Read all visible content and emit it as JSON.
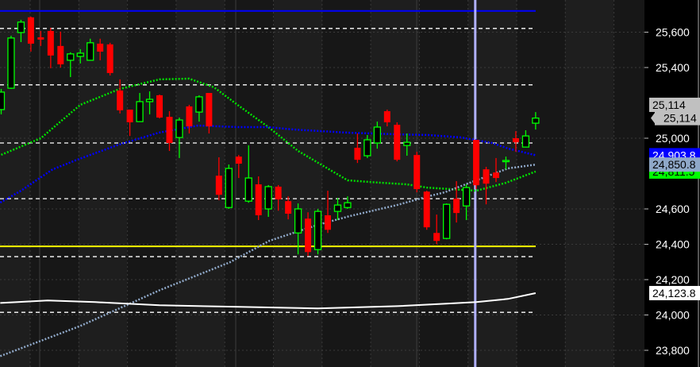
{
  "chart_data": {
    "type": "candlestick",
    "title": "",
    "ylim": [
      23760,
      25760
    ],
    "y_ticks": [
      "25,600",
      "25,400",
      "25,000",
      "24,600",
      "24,400",
      "24,200",
      "24,000",
      "23,800"
    ],
    "y_tick_values": [
      25600,
      25400,
      25000,
      24600,
      24400,
      24200,
      24000,
      23800
    ],
    "grid": true,
    "colors": {
      "up": "#00ff00",
      "down": "#ff0000",
      "background": "#1a1a1a",
      "axis_bg": "#000000"
    },
    "candles": [
      [
        25162,
        25279,
        25135,
        25261
      ],
      [
        25283,
        25580,
        25279,
        25567
      ],
      [
        25598,
        25670,
        25544,
        25657
      ],
      [
        25684,
        25688,
        25490,
        25535
      ],
      [
        25571,
        25607,
        25522,
        25558
      ],
      [
        25607,
        25625,
        25396,
        25468
      ],
      [
        25522,
        25603,
        25400,
        25418
      ],
      [
        25441,
        25486,
        25346,
        25477
      ],
      [
        25463,
        25504,
        25423,
        25481
      ],
      [
        25441,
        25563,
        25441,
        25540
      ],
      [
        25535,
        25563,
        25441,
        25490
      ],
      [
        25531,
        25540,
        25355,
        25369
      ],
      [
        25270,
        25333,
        25140,
        25158
      ],
      [
        25162,
        25162,
        25013,
        25090
      ],
      [
        25094,
        25256,
        25094,
        25207
      ],
      [
        25207,
        25265,
        25135,
        25220
      ],
      [
        25243,
        25247,
        25112,
        25117
      ],
      [
        25121,
        25153,
        24928,
        24973
      ],
      [
        25004,
        25117,
        24888,
        25103
      ],
      [
        25180,
        25189,
        25027,
        25067
      ],
      [
        25148,
        25243,
        25094,
        25234
      ],
      [
        25256,
        25256,
        25027,
        25067
      ],
      [
        24788,
        24892,
        24649,
        24680
      ],
      [
        24608,
        24851,
        24600,
        24829
      ],
      [
        24896,
        24905,
        24775,
        24856
      ],
      [
        24644,
        24960,
        24635,
        24775
      ],
      [
        24739,
        24784,
        24537,
        24564
      ],
      [
        24600,
        24735,
        24555,
        24726
      ],
      [
        24726,
        24735,
        24590,
        24654
      ],
      [
        24644,
        24671,
        24541,
        24573
      ],
      [
        24464,
        24631,
        24343,
        24600
      ],
      [
        24545,
        24581,
        24334,
        24356
      ],
      [
        24370,
        24600,
        24343,
        24586
      ],
      [
        24564,
        24703,
        24464,
        24482
      ],
      [
        24586,
        24662,
        24537,
        24622
      ],
      [
        24608,
        24671,
        24600,
        24635
      ],
      [
        24946,
        25027,
        24860,
        24878
      ],
      [
        24901,
        25018,
        24888,
        24991
      ],
      [
        24973,
        25094,
        24941,
        25063
      ],
      [
        25153,
        25162,
        25067,
        25090
      ],
      [
        25076,
        25090,
        24869,
        24878
      ],
      [
        24959,
        25027,
        24901,
        24977
      ],
      [
        24905,
        24923,
        24694,
        24712
      ],
      [
        24698,
        24703,
        24482,
        24496
      ],
      [
        24464,
        24568,
        24401,
        24419
      ],
      [
        24433,
        24631,
        24428,
        24626
      ],
      [
        24658,
        24757,
        24523,
        24577
      ],
      [
        24617,
        24739,
        24537,
        24721
      ],
      [
        24991,
        24991,
        24712,
        24734
      ],
      [
        24824,
        24838,
        24626,
        24743
      ],
      [
        24806,
        24888,
        24752,
        24775
      ],
      [
        24869,
        24896,
        24824,
        24874
      ],
      [
        25000,
        25040,
        24923,
        24977
      ],
      [
        24950,
        25045,
        24950,
        25013
      ],
      [
        25085,
        25148,
        25049,
        25114
      ]
    ],
    "series": [
      {
        "name": "green-ma",
        "color": "#00e000",
        "style": "dotted",
        "last_label": "24,811.5",
        "points": [
          [
            0,
            24906
          ],
          [
            4,
            25000
          ],
          [
            8,
            25189
          ],
          [
            12,
            25279
          ],
          [
            16,
            25333
          ],
          [
            19,
            25337
          ],
          [
            21.5,
            25288
          ],
          [
            24,
            25184
          ],
          [
            27,
            25063
          ],
          [
            30,
            24928
          ],
          [
            35,
            24762
          ],
          [
            38.4,
            24748
          ],
          [
            41,
            24739
          ],
          [
            43,
            24721
          ],
          [
            48,
            24703
          ],
          [
            51,
            24748
          ],
          [
            54,
            24811.5
          ]
        ]
      },
      {
        "name": "blue-ma",
        "color": "#0000ff",
        "style": "dotted",
        "last_label": "24,903.8",
        "points": [
          [
            -0.1,
            24636
          ],
          [
            2,
            24703
          ],
          [
            5.2,
            24824
          ],
          [
            7.9,
            24883
          ],
          [
            11.9,
            24964
          ],
          [
            15.9,
            25031
          ],
          [
            19.9,
            25072
          ],
          [
            23.9,
            25063
          ],
          [
            27,
            25063
          ],
          [
            29.6,
            25049
          ],
          [
            35.2,
            25031
          ],
          [
            40,
            25022
          ],
          [
            43.2,
            25018
          ],
          [
            46.4,
            25005
          ],
          [
            49.6,
            24973
          ],
          [
            51.2,
            24942
          ],
          [
            54,
            24903.8
          ]
        ]
      },
      {
        "name": "steel-ma",
        "color": "#8fa8c8",
        "style": "dotted",
        "last_label": "24,850.8",
        "points": [
          [
            -0.1,
            23767
          ],
          [
            8,
            23938
          ],
          [
            16,
            24140
          ],
          [
            23.1,
            24298
          ],
          [
            27.1,
            24420
          ],
          [
            32,
            24510
          ],
          [
            35.2,
            24559
          ],
          [
            40,
            24622
          ],
          [
            43.2,
            24672
          ],
          [
            44.8,
            24694
          ],
          [
            48,
            24762
          ],
          [
            51.2,
            24829
          ],
          [
            54,
            24850.8
          ]
        ]
      },
      {
        "name": "white-ma",
        "color": "#ffffff",
        "style": "solid",
        "last_label": "24,123.8",
        "points": [
          [
            -0.1,
            24068
          ],
          [
            4.7,
            24082
          ],
          [
            9.5,
            24073
          ],
          [
            16,
            24055
          ],
          [
            24,
            24046
          ],
          [
            32,
            24037
          ],
          [
            40,
            24050
          ],
          [
            45,
            24064
          ],
          [
            48,
            24073
          ],
          [
            51.2,
            24091
          ],
          [
            54,
            24123.8
          ]
        ]
      }
    ],
    "horizontal_lines": [
      {
        "name": "blue-level",
        "price": 25720,
        "color": "#0000ff",
        "style": "solid"
      },
      {
        "name": "yellow-level",
        "price": 24388,
        "color": "#ffff00",
        "style": "solid"
      },
      {
        "name": "level-1",
        "price": 25621,
        "color": "#ffffff",
        "style": "dashed"
      },
      {
        "name": "level-2",
        "price": 25302,
        "color": "#ffffff",
        "style": "dashed"
      },
      {
        "name": "level-3",
        "price": 24973,
        "color": "#ffffff",
        "style": "dashed"
      },
      {
        "name": "level-4",
        "price": 24658,
        "color": "#ffffff",
        "style": "dashed"
      },
      {
        "name": "level-5",
        "price": 24330,
        "color": "#ffffff",
        "style": "dashed"
      },
      {
        "name": "level-6",
        "price": 24015,
        "color": "#ffffff",
        "style": "dashed"
      }
    ],
    "vertical_marker_candle": 47.9,
    "last_price_labels": [
      "25,114",
      "25,114"
    ]
  }
}
